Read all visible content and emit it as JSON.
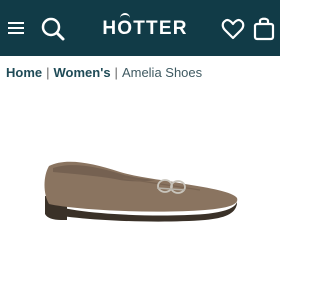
{
  "header": {
    "brand": "HOTTER",
    "brand_before": "H",
    "brand_mark_letter": "O",
    "brand_after": "TTER",
    "icons": {
      "menu": "hamburger-menu-icon",
      "search": "search-icon",
      "wishlist": "heart-icon",
      "bag": "shopping-bag-icon"
    },
    "background_color": "#113b47"
  },
  "breadcrumb": {
    "items": [
      {
        "label": "Home"
      },
      {
        "label": "Women's"
      },
      {
        "label": "Amelia Shoes"
      }
    ],
    "separator": "|"
  },
  "product": {
    "image_alt": "Amelia loafer in taupe suede"
  },
  "colors": {
    "text_primary": "#1f4b57",
    "shoe_suede": "#8a7460",
    "sole": "#3a3128"
  }
}
